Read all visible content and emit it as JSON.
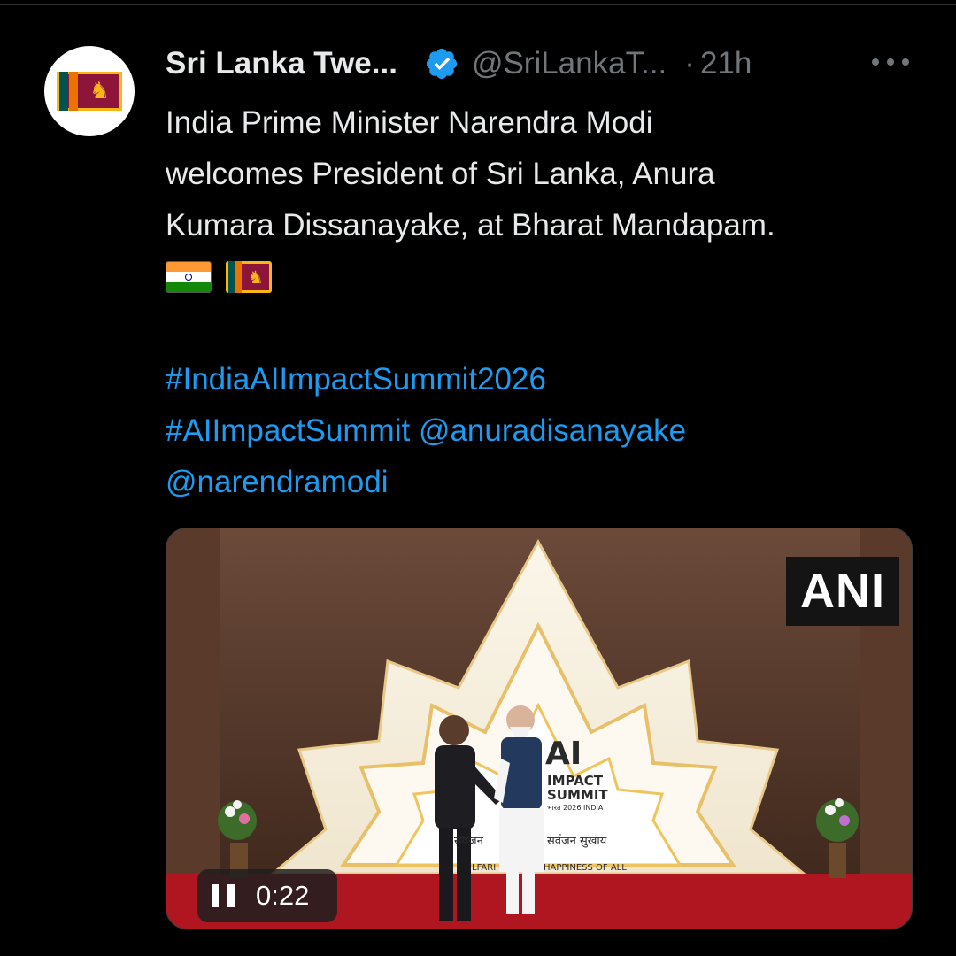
{
  "post": {
    "author_name": "Sri Lanka Twe...",
    "handle": "@SriLankaT...",
    "separator": "·",
    "time": "21h",
    "text_lines": [
      "India Prime Minister Narendra Modi",
      "welcomes President of Sri Lanka, Anura",
      "Kumara Dissanayake, at Bharat Mandapam."
    ],
    "flags": [
      "india-flag-emoji",
      "sri-lanka-flag-emoji"
    ],
    "hashtag_1": "#IndiaAIImpactSummit2026",
    "hashtag_2": "#AIImpactSummit",
    "mention_1": "@anuradisanayake",
    "mention_2": "@narendramodi",
    "avatar_icon": "sri-lanka-flag",
    "verified_icon": "verified-badge-icon",
    "more_icon": "more-options-icon"
  },
  "media": {
    "watermark": "ANI",
    "backdrop_title": "AI",
    "backdrop_line2": "IMPACT",
    "backdrop_line3": "SUMMIT",
    "backdrop_line4": "भारत 2026 INDIA",
    "backdrop_hindi_left": "सर्वजन",
    "backdrop_hindi_right": "सर्वजन सुखाय",
    "backdrop_eng_left": "LFARI",
    "backdrop_eng_right": "HAPPINESS OF ALL",
    "video_time": "0:22",
    "pause_icon": "pause-icon"
  },
  "colors": {
    "background": "#000000",
    "text": "#e7e9ea",
    "secondary": "#71767b",
    "link": "#1d9bf0",
    "verified": "#1d9bf0"
  }
}
